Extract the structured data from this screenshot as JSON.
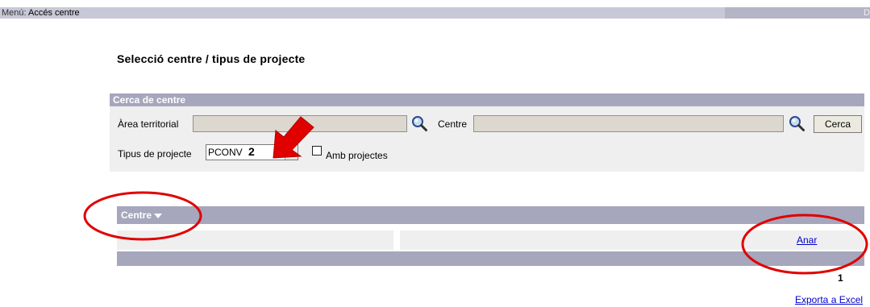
{
  "menu": {
    "label": "Menú:",
    "value": "Accés centre",
    "right_char": "D"
  },
  "page_title": "Selecció centre / tipus de projecte",
  "search": {
    "header": "Cerca de centre",
    "area_label": "Àrea territorial",
    "area_value": "",
    "centre_label": "Centre",
    "centre_value": "",
    "search_button": "Cerca",
    "project_type_label": "Tipus de projecte",
    "project_type_value": "PCONV",
    "annotation_number": "2",
    "checkbox_label": "Amb projectes",
    "checkbox_checked": false
  },
  "grid": {
    "column_header": "Centre",
    "sort_icon": "triangle-down-icon",
    "rows": [
      {
        "centre": "",
        "action": "Anar"
      }
    ]
  },
  "pagination": {
    "current": "1"
  },
  "export_link": "Exporta a Excel",
  "colors": {
    "header_bg": "#a6a6bd",
    "panel_bg": "#efefef",
    "annotation": "#e00000",
    "link": "#0000cc"
  }
}
